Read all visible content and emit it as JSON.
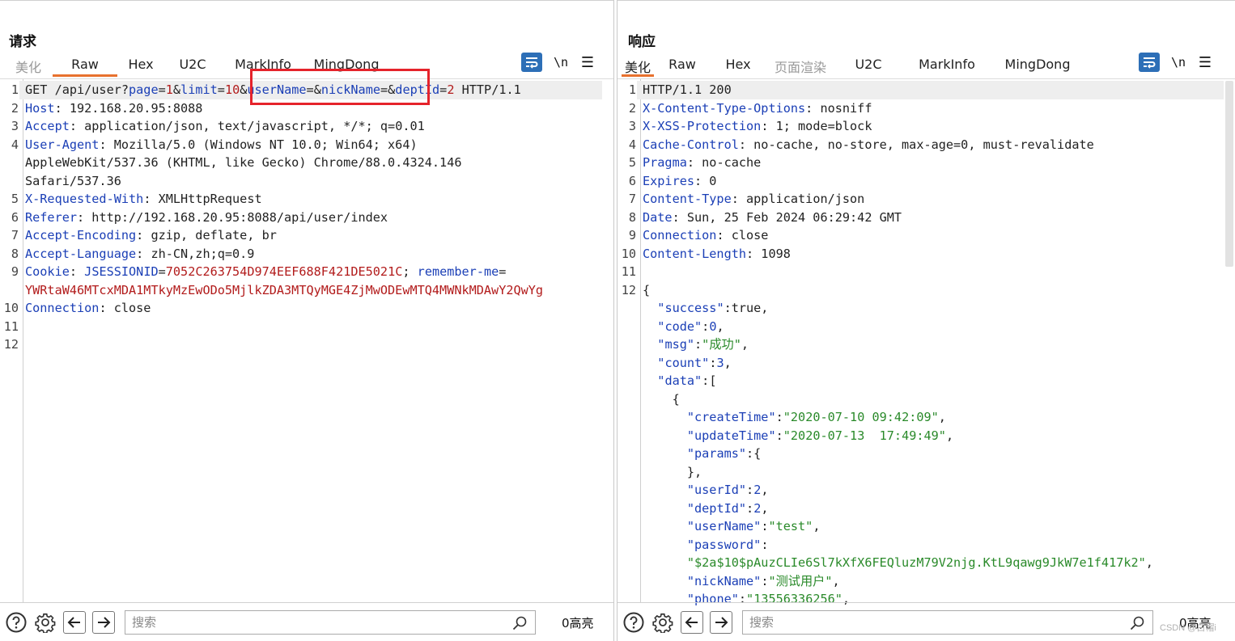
{
  "layout_switch": {
    "options": [
      "side-by-side",
      "horizontal",
      "single"
    ],
    "active": "side-by-side"
  },
  "request": {
    "title": "请求",
    "tabs": [
      {
        "label": "美化",
        "state": "faded"
      },
      {
        "label": "Raw",
        "state": "active"
      },
      {
        "label": "Hex",
        "state": "normal"
      },
      {
        "label": "U2C",
        "state": "normal"
      },
      {
        "label": "MarkInfo",
        "state": "normal"
      },
      {
        "label": "MingDong",
        "state": "normal"
      }
    ],
    "nl_label": "\\n",
    "menu_label": "☰",
    "search": {
      "placeholder": "搜索",
      "hits": "0高亮"
    }
  },
  "response": {
    "title": "响应",
    "tabs": [
      {
        "label": "美化",
        "state": "active"
      },
      {
        "label": "Raw",
        "state": "normal"
      },
      {
        "label": "Hex",
        "state": "normal"
      },
      {
        "label": "页面渲染",
        "state": "faded"
      },
      {
        "label": "U2C",
        "state": "normal"
      },
      {
        "label": "MarkInfo",
        "state": "normal"
      },
      {
        "label": "MingDong",
        "state": "normal"
      }
    ],
    "nl_label": "\\n",
    "menu_label": "☰",
    "search": {
      "placeholder": "搜索",
      "hits": "0高亮"
    }
  },
  "request_lines": [
    {
      "n": "1",
      "hl": true,
      "parts": [
        [
          "v",
          "GET /api/user?"
        ],
        [
          "k",
          "page"
        ],
        [
          "v",
          "="
        ],
        [
          "r",
          "1"
        ],
        [
          "v",
          "&"
        ],
        [
          "k",
          "limit"
        ],
        [
          "v",
          "="
        ],
        [
          "r",
          "10"
        ],
        [
          "v",
          "&"
        ],
        [
          "k",
          "userName"
        ],
        [
          "v",
          "=&"
        ],
        [
          "k",
          "nickName"
        ],
        [
          "v",
          "=&"
        ],
        [
          "k",
          "deptId"
        ],
        [
          "v",
          "="
        ],
        [
          "r",
          "2"
        ],
        [
          "v",
          " HTTP/1.1"
        ]
      ]
    },
    {
      "n": "2",
      "parts": [
        [
          "k",
          "Host"
        ],
        [
          "v",
          ": 192.168.20.95:8088"
        ]
      ]
    },
    {
      "n": "3",
      "parts": [
        [
          "k",
          "Accept"
        ],
        [
          "v",
          ": application/json, text/javascript, */*; q=0.01"
        ]
      ]
    },
    {
      "n": "4",
      "parts": [
        [
          "k",
          "User-Agent"
        ],
        [
          "v",
          ": Mozilla/5.0 (Windows NT 10.0; Win64; x64)"
        ]
      ]
    },
    {
      "n": "",
      "cont": true,
      "parts": [
        [
          "v",
          "AppleWebKit/537.36 (KHTML, like Gecko) Chrome/88.0.4324.146"
        ]
      ]
    },
    {
      "n": "",
      "cont": true,
      "parts": [
        [
          "v",
          "Safari/537.36"
        ]
      ]
    },
    {
      "n": "5",
      "parts": [
        [
          "k",
          "X-Requested-With"
        ],
        [
          "v",
          ": XMLHttpRequest"
        ]
      ]
    },
    {
      "n": "6",
      "parts": [
        [
          "k",
          "Referer"
        ],
        [
          "v",
          ": http://192.168.20.95:8088/api/user/index"
        ]
      ]
    },
    {
      "n": "7",
      "parts": [
        [
          "k",
          "Accept-Encoding"
        ],
        [
          "v",
          ": gzip, deflate, br"
        ]
      ]
    },
    {
      "n": "8",
      "parts": [
        [
          "k",
          "Accept-Language"
        ],
        [
          "v",
          ": zh-CN,zh;q=0.9"
        ]
      ]
    },
    {
      "n": "9",
      "parts": [
        [
          "k",
          "Cookie"
        ],
        [
          "v",
          ": "
        ],
        [
          "k",
          "JSESSIONID"
        ],
        [
          "v",
          "="
        ],
        [
          "r",
          "7052C263754D974EEF688F421DE5021C"
        ],
        [
          "v",
          "; "
        ],
        [
          "k",
          "remember-me"
        ],
        [
          "v",
          "="
        ]
      ]
    },
    {
      "n": "",
      "cont": true,
      "parts": [
        [
          "r",
          "YWRtaW46MTcxMDA1MTkyMzEwODo5MjlkZDA3MTQyMGE4ZjMwODEwMTQ4MWNkMDAwY2QwYg"
        ]
      ]
    },
    {
      "n": "10",
      "parts": [
        [
          "k",
          "Connection"
        ],
        [
          "v",
          ": close"
        ]
      ]
    },
    {
      "n": "11",
      "parts": []
    },
    {
      "n": "12",
      "parts": []
    }
  ],
  "response_lines": [
    {
      "n": "1",
      "hl": true,
      "parts": [
        [
          "v",
          "HTTP/1.1 200"
        ]
      ]
    },
    {
      "n": "2",
      "parts": [
        [
          "k",
          "X-Content-Type-Options"
        ],
        [
          "v",
          ": nosniff"
        ]
      ]
    },
    {
      "n": "3",
      "parts": [
        [
          "k",
          "X-XSS-Protection"
        ],
        [
          "v",
          ": 1; mode=block"
        ]
      ]
    },
    {
      "n": "4",
      "parts": [
        [
          "k",
          "Cache-Control"
        ],
        [
          "v",
          ": no-cache, no-store, max-age=0, must-revalidate"
        ]
      ]
    },
    {
      "n": "5",
      "parts": [
        [
          "k",
          "Pragma"
        ],
        [
          "v",
          ": no-cache"
        ]
      ]
    },
    {
      "n": "6",
      "parts": [
        [
          "k",
          "Expires"
        ],
        [
          "v",
          ": 0"
        ]
      ]
    },
    {
      "n": "7",
      "parts": [
        [
          "k",
          "Content-Type"
        ],
        [
          "v",
          ": application/json"
        ]
      ]
    },
    {
      "n": "8",
      "parts": [
        [
          "k",
          "Date"
        ],
        [
          "v",
          ": Sun, 25 Feb 2024 06:29:42 GMT"
        ]
      ]
    },
    {
      "n": "9",
      "parts": [
        [
          "k",
          "Connection"
        ],
        [
          "v",
          ": close"
        ]
      ]
    },
    {
      "n": "10",
      "parts": [
        [
          "k",
          "Content-Length"
        ],
        [
          "v",
          ": 1098"
        ]
      ]
    },
    {
      "n": "11",
      "parts": []
    },
    {
      "n": "12",
      "parts": [
        [
          "v",
          "{"
        ]
      ]
    },
    {
      "n": "",
      "cont": true,
      "parts": [
        [
          "v",
          "  "
        ],
        [
          "k",
          "\"success\""
        ],
        [
          "v",
          ":true,"
        ]
      ]
    },
    {
      "n": "",
      "cont": true,
      "parts": [
        [
          "v",
          "  "
        ],
        [
          "k",
          "\"code\""
        ],
        [
          "v",
          ":"
        ],
        [
          "b",
          "0"
        ],
        [
          "v",
          ","
        ]
      ]
    },
    {
      "n": "",
      "cont": true,
      "parts": [
        [
          "v",
          "  "
        ],
        [
          "k",
          "\"msg\""
        ],
        [
          "v",
          ":"
        ],
        [
          "g",
          "\"成功\""
        ],
        [
          "v",
          ","
        ]
      ]
    },
    {
      "n": "",
      "cont": true,
      "parts": [
        [
          "v",
          "  "
        ],
        [
          "k",
          "\"count\""
        ],
        [
          "v",
          ":"
        ],
        [
          "b",
          "3"
        ],
        [
          "v",
          ","
        ]
      ]
    },
    {
      "n": "",
      "cont": true,
      "parts": [
        [
          "v",
          "  "
        ],
        [
          "k",
          "\"data\""
        ],
        [
          "v",
          ":["
        ]
      ]
    },
    {
      "n": "",
      "cont": true,
      "parts": [
        [
          "v",
          "    {"
        ]
      ]
    },
    {
      "n": "",
      "cont": true,
      "parts": [
        [
          "v",
          "      "
        ],
        [
          "k",
          "\"createTime\""
        ],
        [
          "v",
          ":"
        ],
        [
          "g",
          "\"2020-07-10 09:42:09\""
        ],
        [
          "v",
          ","
        ]
      ]
    },
    {
      "n": "",
      "cont": true,
      "parts": [
        [
          "v",
          "      "
        ],
        [
          "k",
          "\"updateTime\""
        ],
        [
          "v",
          ":"
        ],
        [
          "g",
          "\"2020-07-13  17:49:49\""
        ],
        [
          "v",
          ","
        ]
      ]
    },
    {
      "n": "",
      "cont": true,
      "parts": [
        [
          "v",
          "      "
        ],
        [
          "k",
          "\"params\""
        ],
        [
          "v",
          ":{"
        ]
      ]
    },
    {
      "n": "",
      "cont": true,
      "parts": [
        [
          "v",
          "      },"
        ]
      ]
    },
    {
      "n": "",
      "cont": true,
      "parts": [
        [
          "v",
          "      "
        ],
        [
          "k",
          "\"userId\""
        ],
        [
          "v",
          ":"
        ],
        [
          "b",
          "2"
        ],
        [
          "v",
          ","
        ]
      ]
    },
    {
      "n": "",
      "cont": true,
      "parts": [
        [
          "v",
          "      "
        ],
        [
          "k",
          "\"deptId\""
        ],
        [
          "v",
          ":"
        ],
        [
          "b",
          "2"
        ],
        [
          "v",
          ","
        ]
      ]
    },
    {
      "n": "",
      "cont": true,
      "parts": [
        [
          "v",
          "      "
        ],
        [
          "k",
          "\"userName\""
        ],
        [
          "v",
          ":"
        ],
        [
          "g",
          "\"test\""
        ],
        [
          "v",
          ","
        ]
      ]
    },
    {
      "n": "",
      "cont": true,
      "parts": [
        [
          "v",
          "      "
        ],
        [
          "k",
          "\"password\""
        ],
        [
          "v",
          ":"
        ]
      ]
    },
    {
      "n": "",
      "cont": true,
      "parts": [
        [
          "v",
          "      "
        ],
        [
          "g",
          "\"$2a$10$pAuzCLIe6Sl7kXfX6FEQluzM79V2njg.KtL9qawg9JkW7e1f417k2\""
        ],
        [
          "v",
          ","
        ]
      ]
    },
    {
      "n": "",
      "cont": true,
      "parts": [
        [
          "v",
          "      "
        ],
        [
          "k",
          "\"nickName\""
        ],
        [
          "v",
          ":"
        ],
        [
          "g",
          "\"测试用户\""
        ],
        [
          "v",
          ","
        ]
      ]
    },
    {
      "n": "",
      "cont": true,
      "parts": [
        [
          "v",
          "      "
        ],
        [
          "k",
          "\"phone\""
        ],
        [
          "v",
          ":"
        ],
        [
          "g",
          "\"13556336256\""
        ],
        [
          "v",
          ","
        ]
      ]
    }
  ],
  "watermark": "CSDN @白帽i"
}
